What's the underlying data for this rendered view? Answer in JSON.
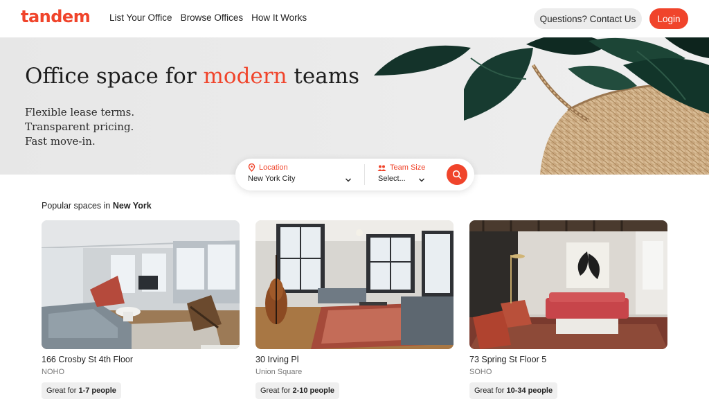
{
  "header": {
    "logo": "tandem",
    "nav": [
      "List Your Office",
      "Browse Offices",
      "How It Works"
    ],
    "contact_label": "Questions? Contact Us",
    "login_label": "Login"
  },
  "hero": {
    "title_pre": "Office space for ",
    "title_accent": "modern",
    "title_post": " teams",
    "lines": [
      "Flexible lease terms.",
      "Transparent pricing.",
      "Fast move-in."
    ]
  },
  "search": {
    "location_label": "Location",
    "location_value": "New York City",
    "team_label": "Team Size",
    "team_value": "Select..."
  },
  "popular": {
    "prefix": "Popular spaces in ",
    "city": "New York"
  },
  "listings": [
    {
      "title": "166 Crosby St 4th Floor",
      "area": "NOHO",
      "tag_prefix": "Great for ",
      "tag_value": "1-7 people"
    },
    {
      "title": "30 Irving Pl",
      "area": "Union Square",
      "tag_prefix": "Great for ",
      "tag_value": "2-10 people"
    },
    {
      "title": "73 Spring St Floor 5",
      "area": "SOHO",
      "tag_prefix": "Great for ",
      "tag_value": "10-34 people"
    }
  ],
  "colors": {
    "accent": "#f0442b",
    "pill": "#ececec"
  }
}
